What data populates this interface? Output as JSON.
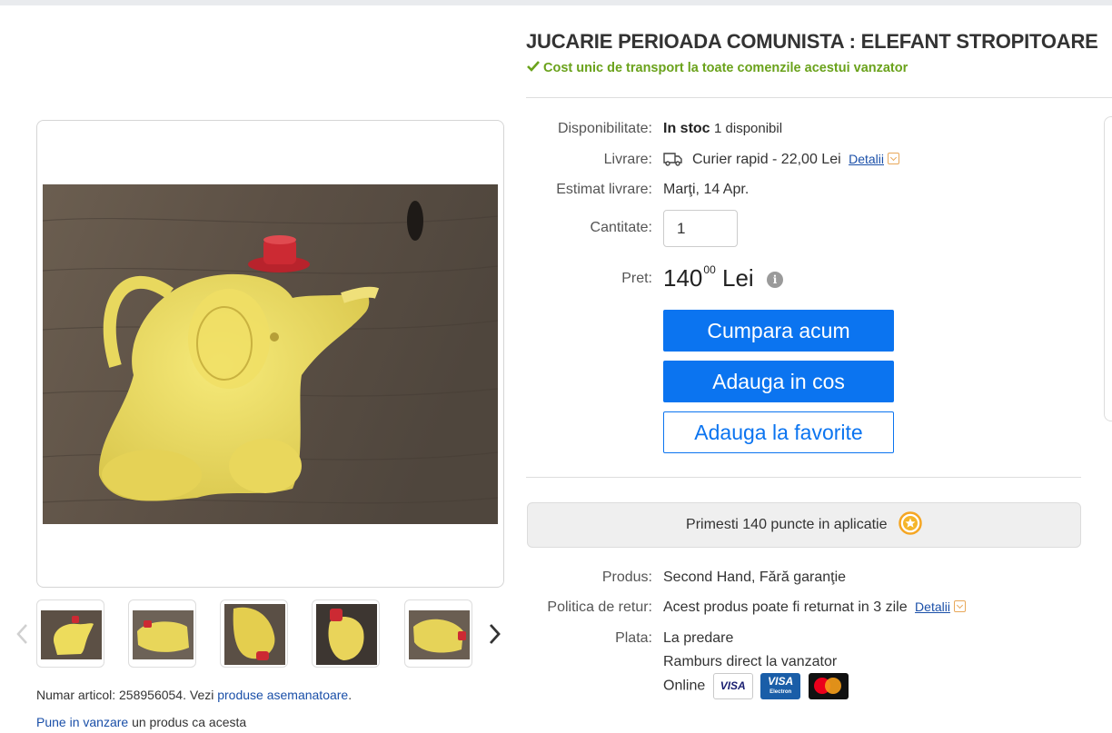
{
  "product": {
    "title": "JUCARIE PERIOADA COMUNISTA : ELEFANT STROPITOARE",
    "shipping_note": "Cost unic de transport la toate comenzile acestui vanzator"
  },
  "details": {
    "availability_label": "Disponibilitate:",
    "availability_status": "In stoc",
    "availability_count": "1 disponibil",
    "delivery_label": "Livrare:",
    "delivery_value": "Curier rapid - 22,00 Lei",
    "delivery_details": "Detalii",
    "estimate_label": "Estimat livrare:",
    "estimate_value": "Marţi, 14 Apr.",
    "quantity_label": "Cantitate:",
    "quantity_value": "1",
    "price_label": "Pret:",
    "price_integer": "140",
    "price_decimals": "00",
    "price_currency": "Lei",
    "info_glyph": "i"
  },
  "actions": {
    "buy_now": "Cumpara acum",
    "add_to_cart": "Adauga in cos",
    "add_to_favorites": "Adauga la favorite"
  },
  "points": {
    "text": "Primesti 140 puncte in aplicatie"
  },
  "more_info": {
    "product_label": "Produs:",
    "product_value": "Second Hand, Fără garanţie",
    "return_label": "Politica de retur:",
    "return_value": "Acest produs poate fi returnat in 3 zile",
    "return_details": "Detalii",
    "payment_label": "Plata:",
    "payment_1": "La predare",
    "payment_2": "Ramburs direct la vanzator",
    "payment_3": "Online",
    "cards": {
      "visa": "VISA",
      "visa_electron": "VISA",
      "visa_electron_sub": "Electron"
    }
  },
  "footer": {
    "article_prefix": "Numar articol: 258956054. Vezi ",
    "similar_link": "produse asemanatoare",
    "article_suffix": ".",
    "sell_link": "Pune in vanzare",
    "sell_suffix": " un produs ca acesta"
  },
  "icons": {
    "check": "check-icon",
    "truck": "truck-icon",
    "caret": "caret-down-icon",
    "info": "info-icon",
    "star": "star-coin-icon",
    "prev": "chevron-left-icon",
    "next": "chevron-right-icon"
  },
  "colors": {
    "primary": "#0b74f0",
    "success": "#6aa21b",
    "link": "#1a4fa8",
    "accent": "#e8a85a"
  }
}
